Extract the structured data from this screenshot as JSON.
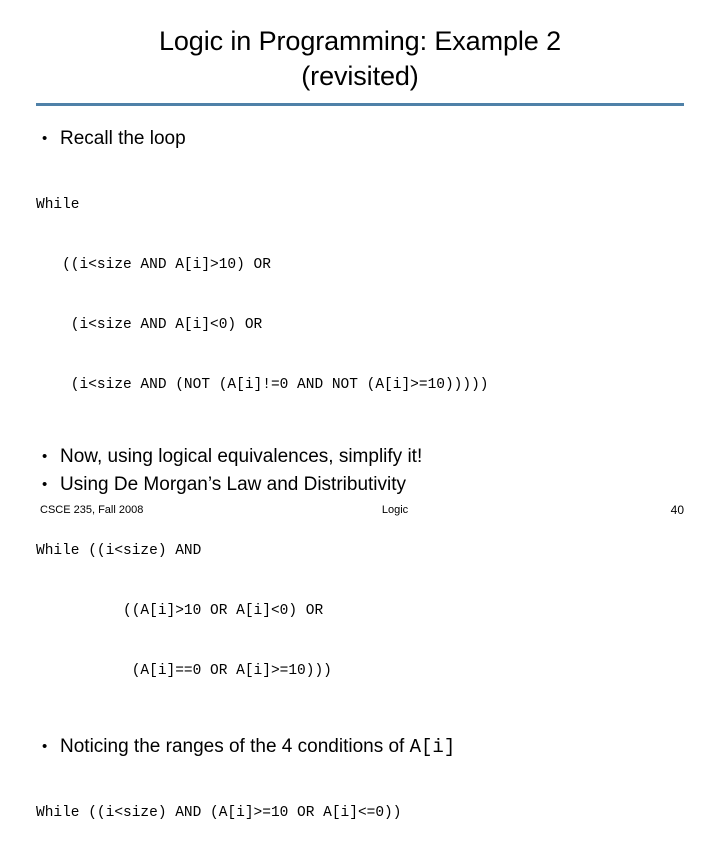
{
  "slide": {
    "title": "Logic in Programming: Example 2\n(revisited)",
    "rule_color": "#4F81A8",
    "bullets": [
      {
        "marker": "•",
        "text": "Recall the loop"
      },
      {
        "marker": "•",
        "text": "Now, using logical equivalences, simplify it!"
      },
      {
        "marker": "•",
        "text": "Using De Morgan’s Law and Distributivity"
      },
      {
        "marker": "•",
        "text_before": "Noticing the ranges of the 4 conditions of ",
        "mono": "A[i]"
      }
    ],
    "code_blocks": [
      {
        "lines": [
          "While",
          "   ((i<size AND A[i]>10) OR",
          "    (i<size AND A[i]<0) OR",
          "    (i<size AND (NOT (A[i]!=0 AND NOT (A[i]>=10)))))"
        ]
      },
      {
        "lines": [
          "While ((i<size) AND",
          "          ((A[i]>10 OR A[i]<0) OR",
          "           (A[i]==0 OR A[i]>=10)))"
        ]
      },
      {
        "lines": [
          "While ((i<size) AND (A[i]>=10 OR A[i]<=0))"
        ]
      }
    ]
  },
  "footer": {
    "left": "CSCE 235, Fall 2008",
    "center": "Logic",
    "right": "40"
  }
}
